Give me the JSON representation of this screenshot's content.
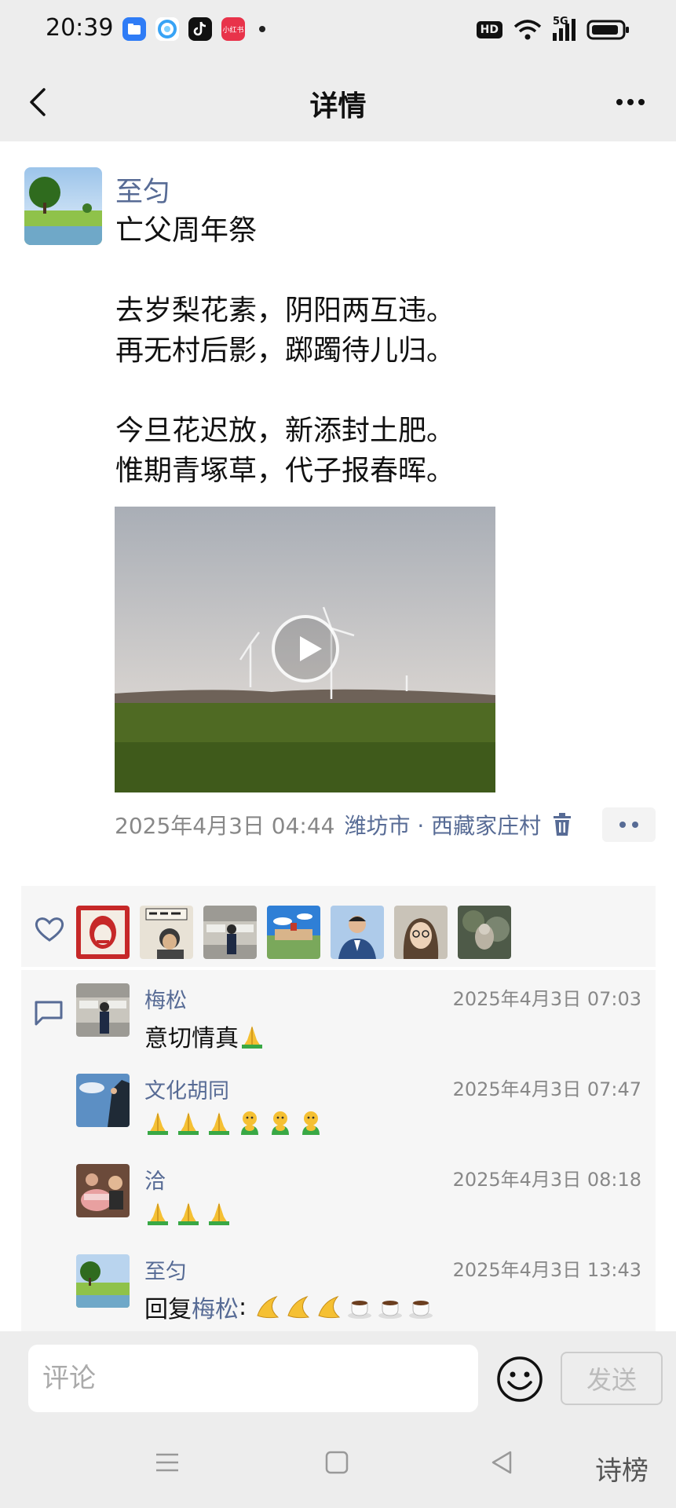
{
  "status_bar": {
    "time": "20:39",
    "app_icons": [
      {
        "name": "files-app-icon",
        "color": "#2f7cf6",
        "label": ""
      },
      {
        "name": "browser-app-icon",
        "color": "#38a3f5",
        "label": ""
      },
      {
        "name": "tiktok-app-icon",
        "color": "#111111",
        "label": ""
      },
      {
        "name": "xiaohongshu-app-icon",
        "color": "#e8334a",
        "label": "小红书"
      }
    ],
    "hd_label": "HD",
    "network_label": "5G"
  },
  "nav": {
    "title": "详情"
  },
  "post": {
    "author": "至匀",
    "lines": [
      "亡父周年祭",
      "",
      "去岁梨花素，阴阳两互违。",
      "再无村后影，踯躅待儿归。",
      "",
      "今旦花迟放，新添封土肥。",
      "惟期青塚草，代子报春晖。"
    ],
    "date": "2025年4月3日 04:44",
    "location": "潍坊市 · 西藏家庄村"
  },
  "likes_count_shown": 7,
  "comments": [
    {
      "name": "梅松",
      "time": "2025年4月3日 07:03",
      "text": "意切情真",
      "emojis": [
        "pray"
      ],
      "reply_to": "",
      "avatar": "av-a"
    },
    {
      "name": "文化胡同",
      "time": "2025年4月3日 07:47",
      "text": "",
      "emojis": [
        "pray",
        "pray",
        "pray",
        "fist",
        "fist",
        "fist"
      ],
      "reply_to": "",
      "avatar": "av-b"
    },
    {
      "name": "洽",
      "time": "2025年4月3日 08:18",
      "text": "",
      "emojis": [
        "pray",
        "pray",
        "pray"
      ],
      "reply_to": "",
      "avatar": "av-c"
    },
    {
      "name": "至匀",
      "time": "2025年4月3日 13:43",
      "text": "回复",
      "emojis": [
        "banana",
        "banana",
        "banana",
        "coffee",
        "coffee",
        "coffee"
      ],
      "reply_to": "梅松",
      "reply_suffix": ": ",
      "avatar": "av-d"
    }
  ],
  "input": {
    "placeholder": "评论",
    "send_label": "发送"
  },
  "watermark": "诗榜",
  "colors": {
    "link": "#576b95",
    "background": "#ededed",
    "card": "#f6f6f6"
  }
}
